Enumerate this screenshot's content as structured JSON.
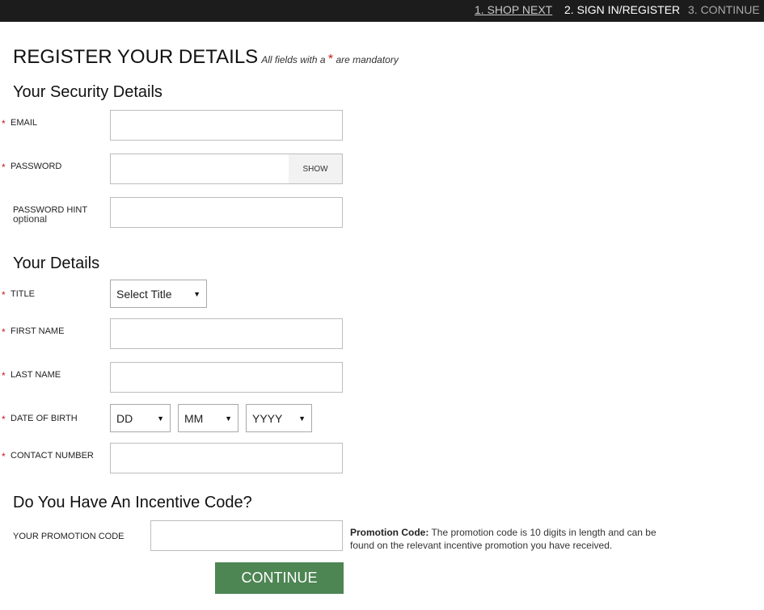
{
  "steps": [
    "1. SHOP NEXT",
    "2. SIGN IN/REGISTER",
    "3. CONTINUE"
  ],
  "title": "REGISTER YOUR DETAILS",
  "mandatory_note_pre": "All fields with a ",
  "mandatory_star": "*",
  "mandatory_note_post": " are mandatory",
  "security": {
    "heading": "Your Security Details",
    "email_label": "EMAIL",
    "password_label": "PASSWORD",
    "show_label": "SHOW",
    "hint_label": "PASSWORD HINT",
    "hint_sub": "optional"
  },
  "details": {
    "heading": "Your Details",
    "title_label": "TITLE",
    "title_value": "Select Title",
    "first_label": "FIRST NAME",
    "last_label": "LAST NAME",
    "dob_label": "DATE OF BIRTH",
    "dob_day": "DD",
    "dob_month": "MM",
    "dob_year": "YYYY",
    "contact_label": "CONTACT NUMBER"
  },
  "incentive": {
    "heading": "Do You Have An Incentive Code?",
    "promo_label": "YOUR PROMOTION CODE",
    "info_bold": "Promotion Code:",
    "info_text": " The promotion code is 10 digits in length and can be found on the relevant incentive promotion you have received."
  },
  "continue_label": "CONTINUE",
  "required_marker": "*",
  "caret_glyph": "▼",
  "colors": {
    "topbar": "#1c1c1c",
    "required": "#c41a1a",
    "continue_button": "#4d8553"
  }
}
